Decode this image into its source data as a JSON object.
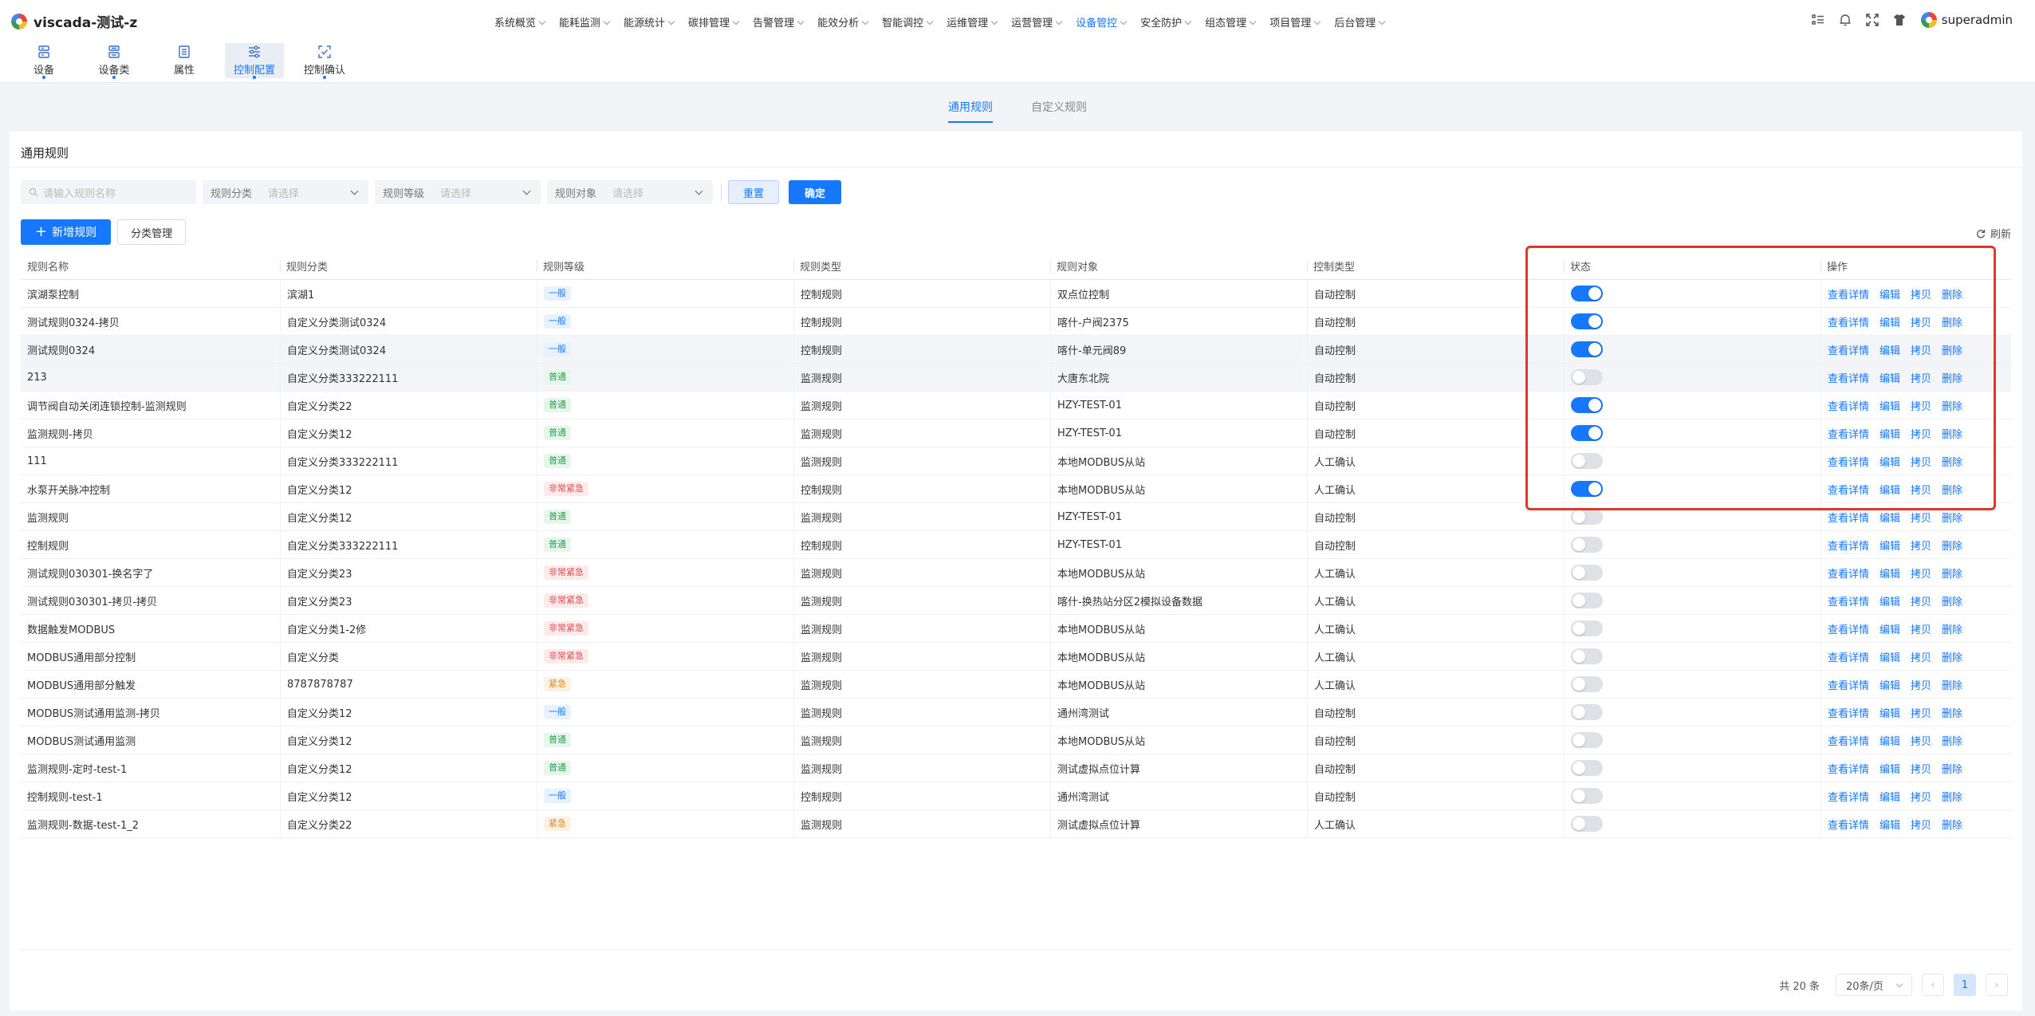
{
  "app": {
    "title": "viscada-测试-z",
    "username": "superadmin"
  },
  "topnav": [
    {
      "label": "系统概览",
      "active": false
    },
    {
      "label": "能耗监测",
      "active": false
    },
    {
      "label": "能源统计",
      "active": false
    },
    {
      "label": "碳排管理",
      "active": false
    },
    {
      "label": "告警管理",
      "active": false
    },
    {
      "label": "能效分析",
      "active": false
    },
    {
      "label": "智能调控",
      "active": false
    },
    {
      "label": "运维管理",
      "active": false
    },
    {
      "label": "运营管理",
      "active": false
    },
    {
      "label": "设备管控",
      "active": true
    },
    {
      "label": "安全防护",
      "active": false
    },
    {
      "label": "组态管理",
      "active": false
    },
    {
      "label": "项目管理",
      "active": false
    },
    {
      "label": "后台管理",
      "active": false
    }
  ],
  "subnav": [
    {
      "label": "设备",
      "icon": "device-icon"
    },
    {
      "label": "设备类",
      "icon": "device-class-icon"
    },
    {
      "label": "属性",
      "icon": "attribute-icon"
    },
    {
      "label": "控制配置",
      "icon": "control-config-icon",
      "active": true
    },
    {
      "label": "控制确认",
      "icon": "control-confirm-icon"
    }
  ],
  "tabs": {
    "general": "通用规则",
    "custom": "自定义规则"
  },
  "card": {
    "title": "通用规则"
  },
  "filters": {
    "name_placeholder": "请输入规则名称",
    "category_label": "规则分类",
    "level_label": "规则等级",
    "target_label": "规则对象",
    "select_placeholder": "请选择",
    "reset": "重置",
    "confirm": "确定"
  },
  "toolbar": {
    "add": "新增规则",
    "category_manage": "分类管理",
    "refresh": "刷新"
  },
  "columns": [
    "规则名称",
    "规则分类",
    "规则等级",
    "规则类型",
    "规则对象",
    "控制类型",
    "状态",
    "操作"
  ],
  "ops": [
    "查看详情",
    "编辑",
    "拷贝",
    "删除"
  ],
  "colors": {
    "primary": "#1677ff",
    "highlight": "#e0362c"
  },
  "rows": [
    {
      "name": "滨湖泵控制",
      "category": "滨湖1",
      "level": "一般",
      "level_color": "blue",
      "type": "控制规则",
      "target": "双点位控制",
      "control": "自动控制",
      "status": true
    },
    {
      "name": "测试规则0324-拷贝",
      "category": "自定义分类测试0324",
      "level": "一般",
      "level_color": "blue",
      "type": "控制规则",
      "target": "喀什-户阀2375",
      "control": "自动控制",
      "status": true
    },
    {
      "name": "测试规则0324",
      "category": "自定义分类测试0324",
      "level": "一般",
      "level_color": "blue",
      "type": "控制规则",
      "target": "喀什-单元阀89",
      "control": "自动控制",
      "status": true
    },
    {
      "name": "213",
      "category": "自定义分类333222111",
      "level": "普通",
      "level_color": "green",
      "type": "监测规则",
      "target": "大唐东北院",
      "control": "自动控制",
      "status": false
    },
    {
      "name": "调节阀自动关闭连锁控制-监测规则",
      "category": "自定义分类22",
      "level": "普通",
      "level_color": "green",
      "type": "监测规则",
      "target": "HZY-TEST-01",
      "control": "自动控制",
      "status": true
    },
    {
      "name": "监测规则-拷贝",
      "category": "自定义分类12",
      "level": "普通",
      "level_color": "green",
      "type": "监测规则",
      "target": "HZY-TEST-01",
      "control": "自动控制",
      "status": true
    },
    {
      "name": "111",
      "category": "自定义分类333222111",
      "level": "普通",
      "level_color": "green",
      "type": "监测规则",
      "target": "本地MODBUS从站",
      "control": "人工确认",
      "status": false
    },
    {
      "name": "水泵开关脉冲控制",
      "category": "自定义分类12",
      "level": "非常紧急",
      "level_color": "red",
      "type": "控制规则",
      "target": "本地MODBUS从站",
      "control": "人工确认",
      "status": true
    },
    {
      "name": "监测规则",
      "category": "自定义分类12",
      "level": "普通",
      "level_color": "green",
      "type": "监测规则",
      "target": "HZY-TEST-01",
      "control": "自动控制",
      "status": false
    },
    {
      "name": "控制规则",
      "category": "自定义分类333222111",
      "level": "普通",
      "level_color": "green",
      "type": "控制规则",
      "target": "HZY-TEST-01",
      "control": "自动控制",
      "status": false
    },
    {
      "name": "测试规则030301-换名字了",
      "category": "自定义分类23",
      "level": "非常紧急",
      "level_color": "red",
      "type": "监测规则",
      "target": "本地MODBUS从站",
      "control": "人工确认",
      "status": false
    },
    {
      "name": "测试规则030301-拷贝-拷贝",
      "category": "自定义分类23",
      "level": "非常紧急",
      "level_color": "red",
      "type": "监测规则",
      "target": "喀什-换热站分区2模拟设备数据",
      "control": "人工确认",
      "status": false
    },
    {
      "name": "数据触发MODBUS",
      "category": "自定义分类1-2修",
      "level": "非常紧急",
      "level_color": "red",
      "type": "监测规则",
      "target": "本地MODBUS从站",
      "control": "人工确认",
      "status": false
    },
    {
      "name": "MODBUS通用部分控制",
      "category": "自定义分类",
      "level": "非常紧急",
      "level_color": "red",
      "type": "监测规则",
      "target": "本地MODBUS从站",
      "control": "人工确认",
      "status": false
    },
    {
      "name": "MODBUS通用部分触发",
      "category": "8787878787",
      "level": "紧急",
      "level_color": "orange",
      "type": "监测规则",
      "target": "本地MODBUS从站",
      "control": "人工确认",
      "status": false
    },
    {
      "name": "MODBUS测试通用监测-拷贝",
      "category": "自定义分类12",
      "level": "一般",
      "level_color": "blue",
      "type": "监测规则",
      "target": "通州湾测试",
      "control": "自动控制",
      "status": false
    },
    {
      "name": "MODBUS测试通用监测",
      "category": "自定义分类12",
      "level": "普通",
      "level_color": "green",
      "type": "监测规则",
      "target": "本地MODBUS从站",
      "control": "自动控制",
      "status": false
    },
    {
      "name": "监测规则-定时-test-1",
      "category": "自定义分类12",
      "level": "普通",
      "level_color": "green",
      "type": "监测规则",
      "target": "测试虚拟点位计算",
      "control": "自动控制",
      "status": false
    },
    {
      "name": "控制规则-test-1",
      "category": "自定义分类12",
      "level": "一般",
      "level_color": "blue",
      "type": "控制规则",
      "target": "通州湾测试",
      "control": "自动控制",
      "status": false
    },
    {
      "name": "监测规则-数据-test-1_2",
      "category": "自定义分类22",
      "level": "紧急",
      "level_color": "orange",
      "type": "监测规则",
      "target": "测试虚拟点位计算",
      "control": "人工确认",
      "status": false
    }
  ],
  "pagination": {
    "total": "共 20 条",
    "page_size": "20条/页",
    "current": "1",
    "prev": "‹",
    "next": "›"
  }
}
